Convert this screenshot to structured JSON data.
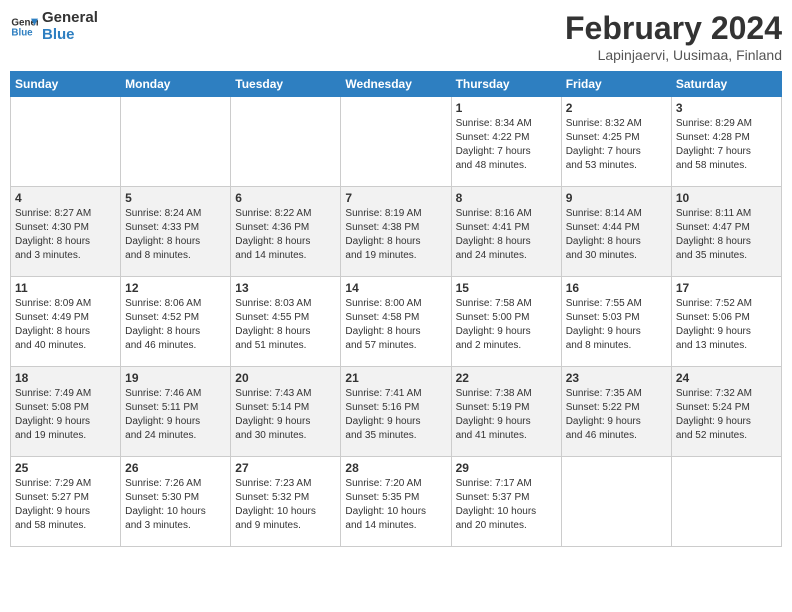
{
  "header": {
    "logo_line1": "General",
    "logo_line2": "Blue",
    "title": "February 2024",
    "subtitle": "Lapinjaervi, Uusimaa, Finland"
  },
  "days_of_week": [
    "Sunday",
    "Monday",
    "Tuesday",
    "Wednesday",
    "Thursday",
    "Friday",
    "Saturday"
  ],
  "weeks": [
    [
      {
        "day": "",
        "info": ""
      },
      {
        "day": "",
        "info": ""
      },
      {
        "day": "",
        "info": ""
      },
      {
        "day": "",
        "info": ""
      },
      {
        "day": "1",
        "info": "Sunrise: 8:34 AM\nSunset: 4:22 PM\nDaylight: 7 hours\nand 48 minutes."
      },
      {
        "day": "2",
        "info": "Sunrise: 8:32 AM\nSunset: 4:25 PM\nDaylight: 7 hours\nand 53 minutes."
      },
      {
        "day": "3",
        "info": "Sunrise: 8:29 AM\nSunset: 4:28 PM\nDaylight: 7 hours\nand 58 minutes."
      }
    ],
    [
      {
        "day": "4",
        "info": "Sunrise: 8:27 AM\nSunset: 4:30 PM\nDaylight: 8 hours\nand 3 minutes."
      },
      {
        "day": "5",
        "info": "Sunrise: 8:24 AM\nSunset: 4:33 PM\nDaylight: 8 hours\nand 8 minutes."
      },
      {
        "day": "6",
        "info": "Sunrise: 8:22 AM\nSunset: 4:36 PM\nDaylight: 8 hours\nand 14 minutes."
      },
      {
        "day": "7",
        "info": "Sunrise: 8:19 AM\nSunset: 4:38 PM\nDaylight: 8 hours\nand 19 minutes."
      },
      {
        "day": "8",
        "info": "Sunrise: 8:16 AM\nSunset: 4:41 PM\nDaylight: 8 hours\nand 24 minutes."
      },
      {
        "day": "9",
        "info": "Sunrise: 8:14 AM\nSunset: 4:44 PM\nDaylight: 8 hours\nand 30 minutes."
      },
      {
        "day": "10",
        "info": "Sunrise: 8:11 AM\nSunset: 4:47 PM\nDaylight: 8 hours\nand 35 minutes."
      }
    ],
    [
      {
        "day": "11",
        "info": "Sunrise: 8:09 AM\nSunset: 4:49 PM\nDaylight: 8 hours\nand 40 minutes."
      },
      {
        "day": "12",
        "info": "Sunrise: 8:06 AM\nSunset: 4:52 PM\nDaylight: 8 hours\nand 46 minutes."
      },
      {
        "day": "13",
        "info": "Sunrise: 8:03 AM\nSunset: 4:55 PM\nDaylight: 8 hours\nand 51 minutes."
      },
      {
        "day": "14",
        "info": "Sunrise: 8:00 AM\nSunset: 4:58 PM\nDaylight: 8 hours\nand 57 minutes."
      },
      {
        "day": "15",
        "info": "Sunrise: 7:58 AM\nSunset: 5:00 PM\nDaylight: 9 hours\nand 2 minutes."
      },
      {
        "day": "16",
        "info": "Sunrise: 7:55 AM\nSunset: 5:03 PM\nDaylight: 9 hours\nand 8 minutes."
      },
      {
        "day": "17",
        "info": "Sunrise: 7:52 AM\nSunset: 5:06 PM\nDaylight: 9 hours\nand 13 minutes."
      }
    ],
    [
      {
        "day": "18",
        "info": "Sunrise: 7:49 AM\nSunset: 5:08 PM\nDaylight: 9 hours\nand 19 minutes."
      },
      {
        "day": "19",
        "info": "Sunrise: 7:46 AM\nSunset: 5:11 PM\nDaylight: 9 hours\nand 24 minutes."
      },
      {
        "day": "20",
        "info": "Sunrise: 7:43 AM\nSunset: 5:14 PM\nDaylight: 9 hours\nand 30 minutes."
      },
      {
        "day": "21",
        "info": "Sunrise: 7:41 AM\nSunset: 5:16 PM\nDaylight: 9 hours\nand 35 minutes."
      },
      {
        "day": "22",
        "info": "Sunrise: 7:38 AM\nSunset: 5:19 PM\nDaylight: 9 hours\nand 41 minutes."
      },
      {
        "day": "23",
        "info": "Sunrise: 7:35 AM\nSunset: 5:22 PM\nDaylight: 9 hours\nand 46 minutes."
      },
      {
        "day": "24",
        "info": "Sunrise: 7:32 AM\nSunset: 5:24 PM\nDaylight: 9 hours\nand 52 minutes."
      }
    ],
    [
      {
        "day": "25",
        "info": "Sunrise: 7:29 AM\nSunset: 5:27 PM\nDaylight: 9 hours\nand 58 minutes."
      },
      {
        "day": "26",
        "info": "Sunrise: 7:26 AM\nSunset: 5:30 PM\nDaylight: 10 hours\nand 3 minutes."
      },
      {
        "day": "27",
        "info": "Sunrise: 7:23 AM\nSunset: 5:32 PM\nDaylight: 10 hours\nand 9 minutes."
      },
      {
        "day": "28",
        "info": "Sunrise: 7:20 AM\nSunset: 5:35 PM\nDaylight: 10 hours\nand 14 minutes."
      },
      {
        "day": "29",
        "info": "Sunrise: 7:17 AM\nSunset: 5:37 PM\nDaylight: 10 hours\nand 20 minutes."
      },
      {
        "day": "",
        "info": ""
      },
      {
        "day": "",
        "info": ""
      }
    ]
  ]
}
